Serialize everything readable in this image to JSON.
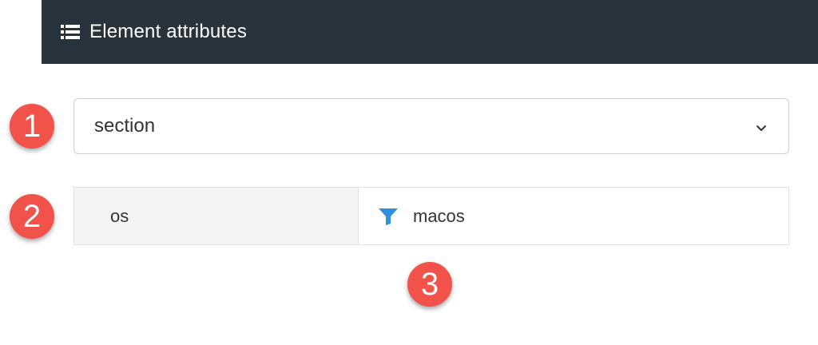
{
  "header": {
    "icon": "list-icon",
    "title": "Element attributes"
  },
  "markers": [
    "1",
    "2",
    "3"
  ],
  "element_select": {
    "value": "section",
    "icon": "chevron-down-icon"
  },
  "attribute_row": {
    "key": "os",
    "value": "macos",
    "filter_icon": "filter-icon",
    "filter_color": "#2f8fe0"
  },
  "colors": {
    "header_bg": "#29333b",
    "marker_bg": "#f1524a"
  }
}
